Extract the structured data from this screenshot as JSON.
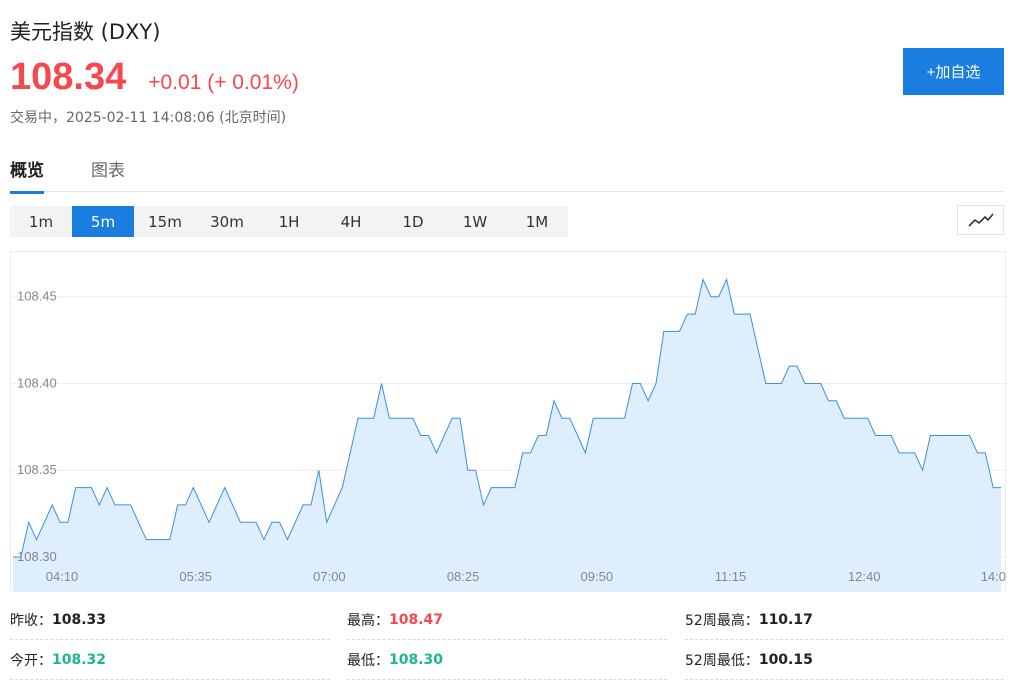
{
  "header": {
    "title": "美元指数 (DXY)",
    "price": "108.34",
    "change": "+0.01 (+ 0.01%)",
    "status": "交易中，2025-02-11 14:08:06 (北京时间)",
    "add_label": "+加自选"
  },
  "tabs": [
    {
      "label": "概览",
      "active": true
    },
    {
      "label": "图表",
      "active": false
    }
  ],
  "periods": [
    {
      "label": "1m",
      "active": false
    },
    {
      "label": "5m",
      "active": true
    },
    {
      "label": "15m",
      "active": false
    },
    {
      "label": "30m",
      "active": false
    },
    {
      "label": "1H",
      "active": false
    },
    {
      "label": "4H",
      "active": false
    },
    {
      "label": "1D",
      "active": false
    },
    {
      "label": "1W",
      "active": false
    },
    {
      "label": "1M",
      "active": false
    }
  ],
  "chart_type_icon": "line-chart-icon",
  "chart_data": {
    "type": "area",
    "title": "",
    "xlabel": "",
    "ylabel": "",
    "x_ticks": [
      "04:10",
      "05:35",
      "07:00",
      "08:25",
      "09:50",
      "11:15",
      "12:40",
      "14:0"
    ],
    "y_ticks": [
      "108.30",
      "108.35",
      "108.40",
      "108.45"
    ],
    "ylim": [
      108.3,
      108.47
    ],
    "grid": true,
    "line_color": "#3a8ee6",
    "fill_color": "#deeefc",
    "series": [
      {
        "values": [
          108.3,
          108.3,
          108.32,
          108.31,
          108.32,
          108.33,
          108.32,
          108.32,
          108.34,
          108.34,
          108.34,
          108.33,
          108.34,
          108.33,
          108.33,
          108.33,
          108.32,
          108.31,
          108.31,
          108.31,
          108.31,
          108.33,
          108.33,
          108.34,
          108.33,
          108.32,
          108.33,
          108.34,
          108.33,
          108.32,
          108.32,
          108.32,
          108.31,
          108.32,
          108.32,
          108.31,
          108.32,
          108.33,
          108.33,
          108.35,
          108.32,
          108.33,
          108.34,
          108.36,
          108.38,
          108.38,
          108.38,
          108.4,
          108.38,
          108.38,
          108.38,
          108.38,
          108.37,
          108.37,
          108.36,
          108.37,
          108.38,
          108.38,
          108.35,
          108.35,
          108.33,
          108.34,
          108.34,
          108.34,
          108.34,
          108.36,
          108.36,
          108.37,
          108.37,
          108.39,
          108.38,
          108.38,
          108.37,
          108.36,
          108.38,
          108.38,
          108.38,
          108.38,
          108.38,
          108.4,
          108.4,
          108.39,
          108.4,
          108.43,
          108.43,
          108.43,
          108.44,
          108.44,
          108.46,
          108.45,
          108.45,
          108.46,
          108.44,
          108.44,
          108.44,
          108.42,
          108.4,
          108.4,
          108.4,
          108.41,
          108.41,
          108.4,
          108.4,
          108.4,
          108.39,
          108.39,
          108.38,
          108.38,
          108.38,
          108.38,
          108.37,
          108.37,
          108.37,
          108.36,
          108.36,
          108.36,
          108.35,
          108.37,
          108.37,
          108.37,
          108.37,
          108.37,
          108.37,
          108.36,
          108.36,
          108.34,
          108.34
        ]
      }
    ]
  },
  "stats": {
    "prev_close_label": "昨收：",
    "prev_close": "108.33",
    "open_label": "今开：",
    "open": "108.32",
    "high_label": "最高：",
    "high": "108.47",
    "low_label": "最低：",
    "low": "108.30",
    "w52_high_label": "52周最高：",
    "w52_high": "110.17",
    "w52_low_label": "52周最低：",
    "w52_low": "100.15"
  },
  "colors": {
    "up": "#f5484f",
    "down": "#1cb78e",
    "accent": "#1a7ee0"
  }
}
